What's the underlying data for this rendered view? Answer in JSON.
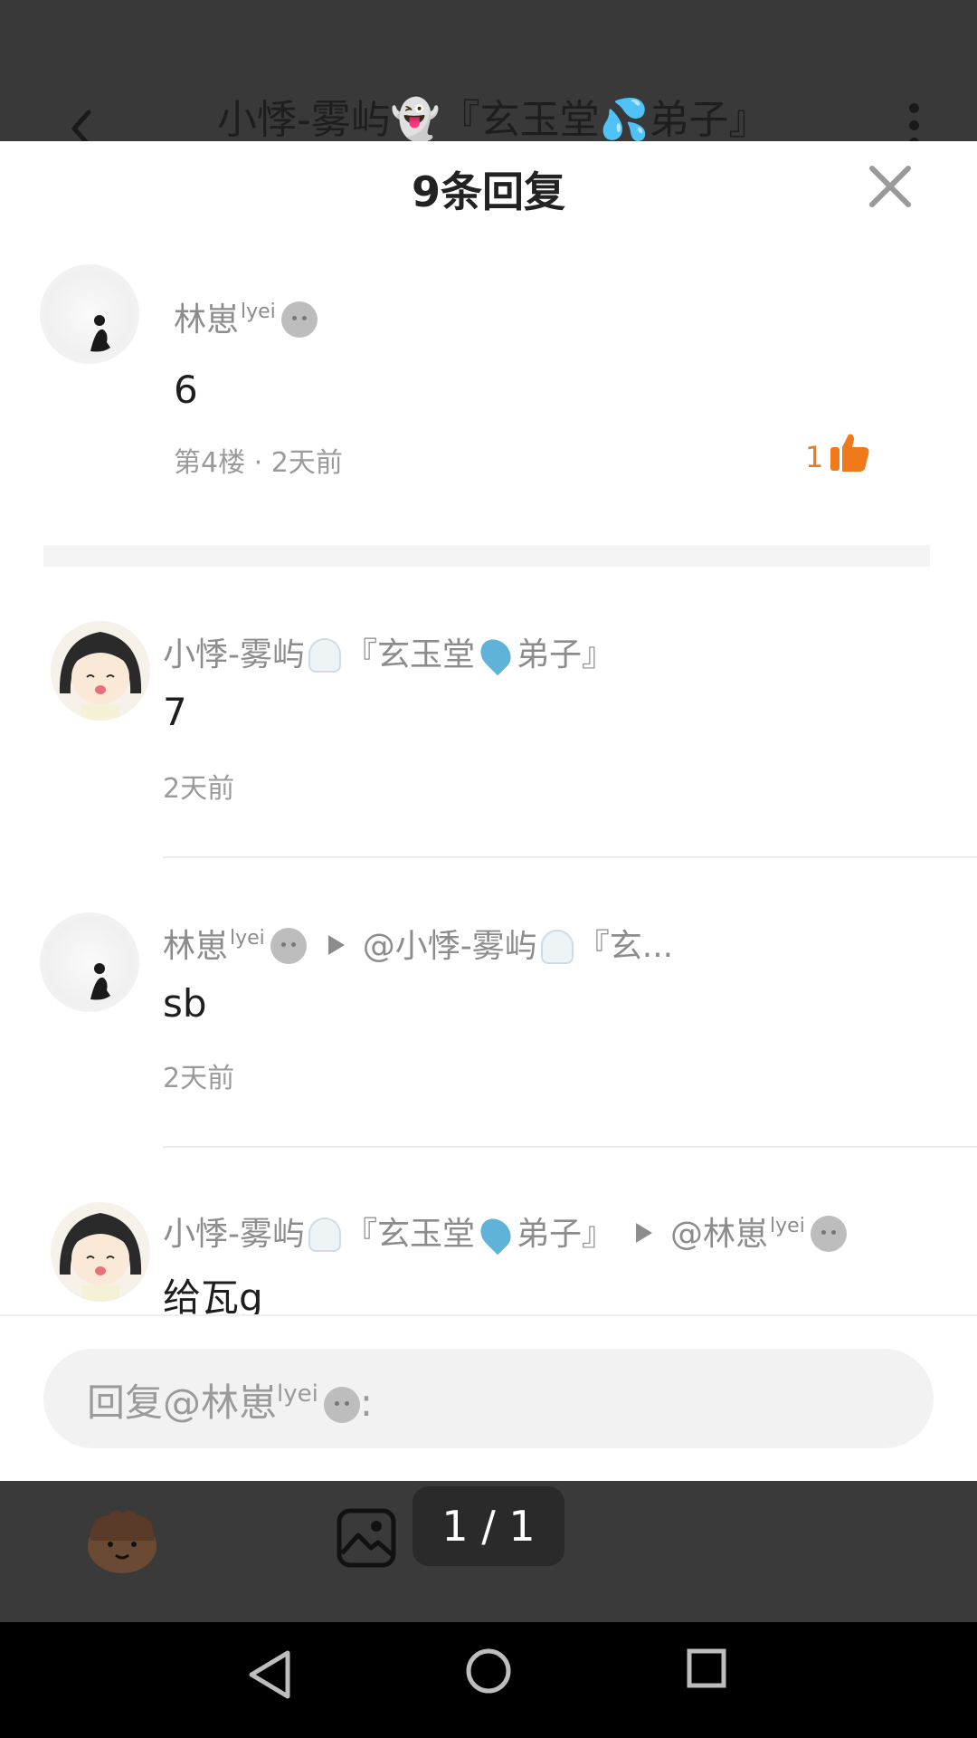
{
  "app_header": {
    "title": "小悸-雾屿👻『玄玉堂💦弟子』"
  },
  "sheet": {
    "title": "9条回复"
  },
  "main_post": {
    "user_name": "林崽",
    "user_name_sup": "lyei",
    "content": "6",
    "meta": "第4楼 · 2天前",
    "like_count": "1"
  },
  "replies": [
    {
      "user_name": "小悸-雾屿",
      "name_suffix_a": "『玄玉堂",
      "name_suffix_b": "弟子』",
      "content": "7",
      "time": "2天前"
    },
    {
      "user_name": "林崽",
      "user_name_sup": "lyei",
      "reply_target_a": "@小悸-雾屿",
      "reply_target_b": "『玄...",
      "content": "sb",
      "time": "2天前"
    },
    {
      "user_name": "小悸-雾屿",
      "name_suffix_a": "『玄玉堂",
      "name_suffix_b": "弟子』",
      "reply_target": "@林崽",
      "reply_target_sup": "lyei",
      "content": "给瓦g"
    }
  ],
  "reply_input": {
    "prefix": "回复@林崽",
    "sup": "lyei",
    "suffix": ":"
  },
  "toolbar": {
    "page_indicator": "1 / 1"
  },
  "colors": {
    "like_orange": "#f07a1a",
    "sheet_bg": "#ffffff",
    "dim_bg": "#3a3a3a"
  }
}
